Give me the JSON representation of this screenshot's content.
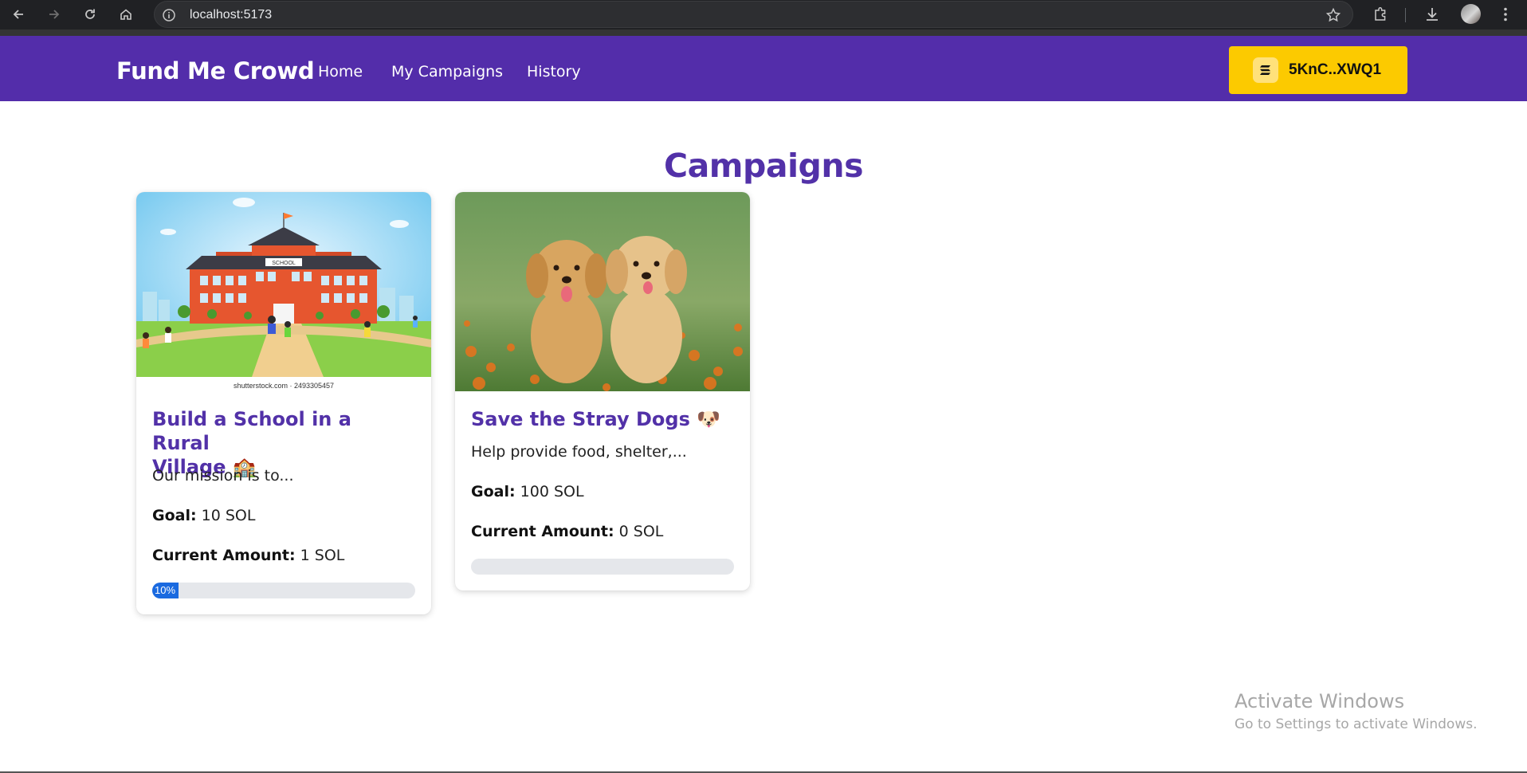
{
  "browser": {
    "url": "localhost:5173",
    "icons": [
      "back-icon",
      "forward-icon",
      "reload-icon",
      "home-icon",
      "site-info-icon",
      "bookmark-star-icon",
      "extensions-icon",
      "download-icon",
      "profile-avatar",
      "more-menu-icon"
    ]
  },
  "navbar": {
    "brand": "Fund Me Crowd",
    "links": [
      "Home",
      "My Campaigns",
      "History"
    ],
    "wallet_label": "5KnC..XWQ1",
    "colors": {
      "background": "#532daa",
      "wallet": "#fcca00"
    }
  },
  "main": {
    "title": "Campaigns",
    "campaigns": [
      {
        "title_line1": "Build a School in a Rural",
        "title_line2": "Village 🏫",
        "image_caption": "shutterstock.com · 2493305457",
        "description": "Our mission is to...",
        "goal_label": "Goal:",
        "goal_value": "10 SOL",
        "current_label": "Current Amount:",
        "current_value": "1 SOL",
        "progress_text": "10%",
        "progress_fraction": 0.1
      },
      {
        "title_line1": "Save the Stray Dogs 🐶",
        "description": "Help provide food, shelter,...",
        "goal_label": "Goal:",
        "goal_value": "100 SOL",
        "current_label": "Current Amount:",
        "current_value": "0 SOL",
        "progress_text": "",
        "progress_fraction": 0
      }
    ]
  },
  "os_watermark": {
    "line1": "Activate Windows",
    "line2": "Go to Settings to activate Windows."
  },
  "colors": {
    "accent": "#5231a8",
    "progress": "#1a6ae0"
  }
}
